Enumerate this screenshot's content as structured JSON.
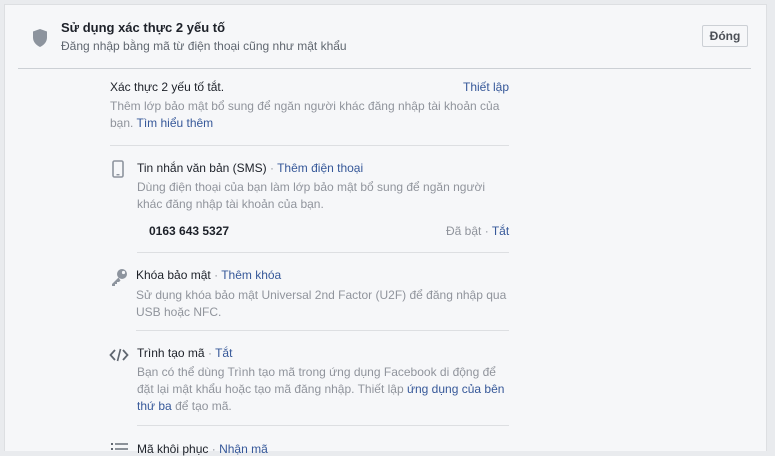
{
  "header": {
    "title": "Sử dụng xác thực 2 yếu tố",
    "subtitle": "Đăng nhập bằng mã từ điện thoại cũng như mật khẩu",
    "close_label": "Đóng"
  },
  "overview": {
    "status": "Xác thực 2 yếu tố tắt.",
    "setup_link": "Thiết lập",
    "description": "Thêm lớp bảo mật bổ sung để ngăn người khác đăng nhập tài khoản của bạn.",
    "learn_more": "Tìm hiểu thêm"
  },
  "methods": {
    "sms": {
      "title": "Tin nhắn văn bản (SMS)",
      "separator": "·",
      "action": "Thêm điện thoại",
      "description": "Dùng điện thoại của bạn làm lớp bảo mật bổ sung để ngăn người khác đăng nhập tài khoản của bạn.",
      "phone": "0163 643 5327",
      "status": "Đã bật",
      "toggle": "Tắt"
    },
    "security_key": {
      "title": "Khóa bảo mật",
      "separator": "·",
      "action": "Thêm khóa",
      "description": "Sử dụng khóa bảo mật Universal 2nd Factor (U2F) để đăng nhập qua USB hoặc NFC."
    },
    "code_generator": {
      "title": "Trình tạo mã",
      "separator": "·",
      "action": "Tắt",
      "description_before": "Bạn có thể dùng Trình tạo mã trong ứng dụng Facebook di động để đặt lại mật khẩu hoặc tạo mã đăng nhập. Thiết lập ",
      "description_link": "ứng dụng của bên thứ ba",
      "description_after": " để tạo mã."
    },
    "recovery_codes": {
      "title": "Mã khôi phục",
      "separator": "·",
      "action": "Nhận mã"
    }
  },
  "icons": [
    "shield-icon",
    "phone-icon",
    "key-icon",
    "code-icon",
    "list-icon"
  ],
  "colors": {
    "link": "#365899",
    "muted": "#90949c",
    "text": "#1d2129"
  }
}
